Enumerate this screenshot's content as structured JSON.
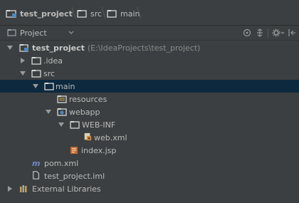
{
  "breadcrumb": {
    "items": [
      "test_project",
      "src",
      "main"
    ]
  },
  "tool_window": {
    "title": "Project"
  },
  "tree": {
    "root_label": "test_project",
    "root_path": "(E:\\IdeaProjects\\test_project)",
    "items": {
      "idea": ".idea",
      "src": "src",
      "main": "main",
      "resources": "resources",
      "webapp": "webapp",
      "webinf": "WEB-INF",
      "webxml": "web.xml",
      "indexjsp": "index.jsp",
      "pomxml": "pom.xml",
      "iml": "test_project.iml",
      "extlib": "External Libraries"
    }
  },
  "colors": {
    "background": "#3c3f41",
    "selection": "#0d293e",
    "folder": "#d7d7d7",
    "text": "#bbbbbb"
  }
}
